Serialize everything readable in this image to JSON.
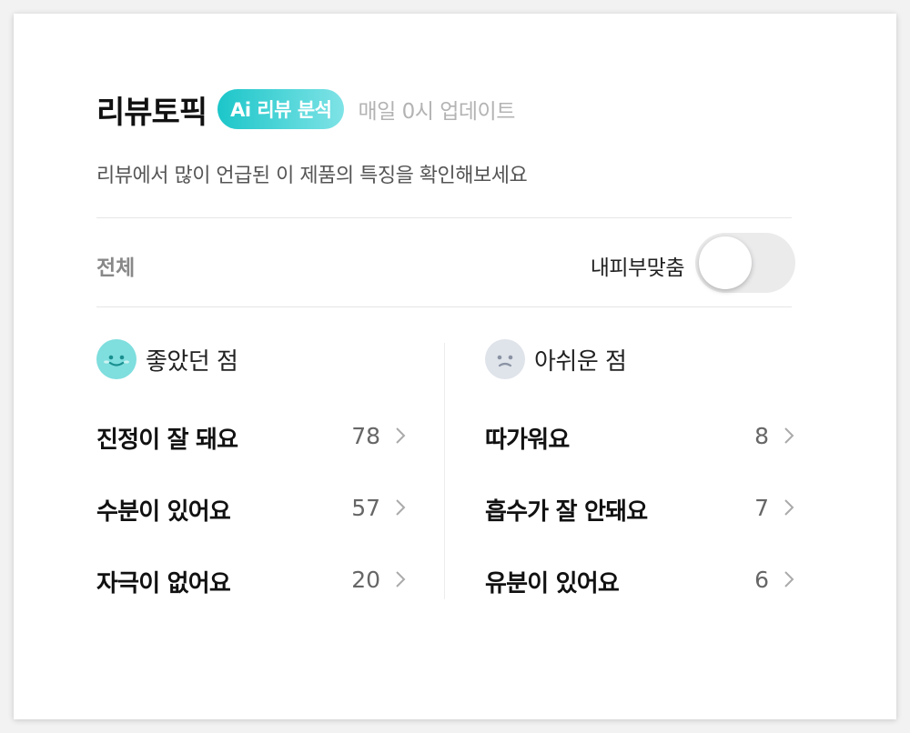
{
  "header": {
    "title": "리뷰토픽",
    "badge": "Ai 리뷰 분석",
    "update_note": "매일 0시 업데이트",
    "subtitle": "리뷰에서 많이 언급된 이 제품의 특징을 확인해보세요"
  },
  "filter": {
    "all_label": "전체",
    "toggle_label": "내피부맞춤",
    "toggle_on": false
  },
  "good": {
    "icon": "happy-face-icon",
    "title": "좋았던 점",
    "items": [
      {
        "label": "진정이 잘 돼요",
        "count": "78"
      },
      {
        "label": "수분이 있어요",
        "count": "57"
      },
      {
        "label": "자극이 없어요",
        "count": "20"
      }
    ]
  },
  "bad": {
    "icon": "sad-face-icon",
    "title": "아쉬운 점",
    "items": [
      {
        "label": "따가워요",
        "count": "8"
      },
      {
        "label": "흡수가 잘 안돼요",
        "count": "7"
      },
      {
        "label": "유분이 있어요",
        "count": "6"
      }
    ]
  },
  "colors": {
    "accent_start": "#1cc6c9",
    "accent_end": "#7fe3e6",
    "happy_face": "#7fdede",
    "sad_face": "#dfe3ea"
  }
}
